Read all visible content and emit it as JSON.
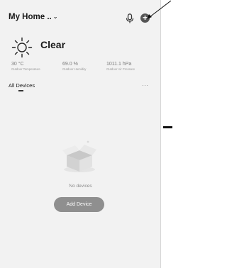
{
  "header": {
    "title": "My Home ..",
    "chevron": "⌄",
    "mic_icon": "microphone-icon",
    "add_icon": "plus-circle-icon",
    "add_glyph": "+"
  },
  "weather": {
    "icon": "sun-icon",
    "condition": "Clear",
    "stats": [
      {
        "value": "30 °C",
        "label": "Outdoor Temperature"
      },
      {
        "value": "69.0 %",
        "label": "Outdoor Humidity"
      },
      {
        "value": "1011.1 hPa",
        "label": "Outdoor Air Pressure"
      }
    ]
  },
  "devices": {
    "tab_label": "All Devices",
    "more_glyph": "···",
    "empty_text": "No devices",
    "add_button_label": "Add Device"
  },
  "colors": {
    "background": "#f2f2f2",
    "button": "#8f8f8f",
    "text": "#1a1a1a"
  }
}
